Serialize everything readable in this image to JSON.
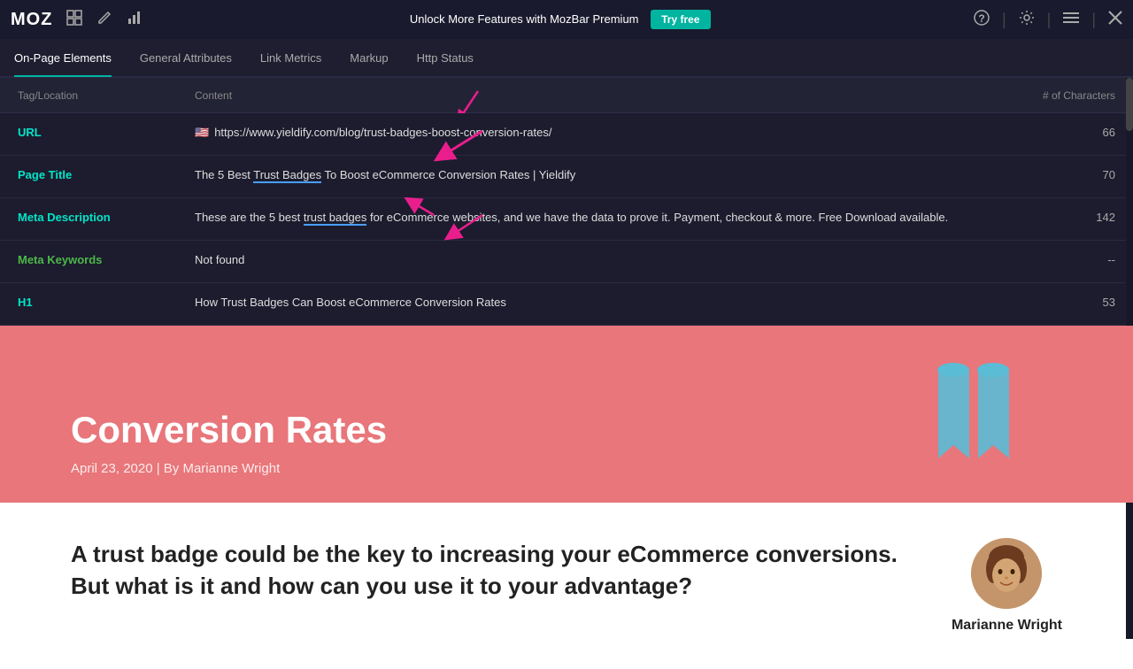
{
  "topbar": {
    "logo": "MOZ",
    "promo_text": "Unlock More Features with MozBar Premium",
    "try_free_label": "Try free",
    "icons": [
      "grid-icon",
      "edit-icon",
      "chart-icon"
    ]
  },
  "tabs": [
    {
      "label": "On-Page Elements",
      "active": true
    },
    {
      "label": "General Attributes",
      "active": false
    },
    {
      "label": "Link Metrics",
      "active": false
    },
    {
      "label": "Markup",
      "active": false
    },
    {
      "label": "Http Status",
      "active": false
    }
  ],
  "table": {
    "headers": {
      "tag": "Tag/Location",
      "content": "Content",
      "chars": "# of Characters"
    },
    "rows": [
      {
        "tag": "URL",
        "tag_color": "cyan",
        "content": "https://www.yieldify.com/blog/trust-badges-boost-conversion-rates/",
        "chars": "66",
        "is_url": true
      },
      {
        "tag": "Page Title",
        "tag_color": "cyan",
        "content": "The 5 Best Trust Badges To Boost eCommerce Conversion Rates | Yieldify",
        "chars": "70",
        "is_url": false
      },
      {
        "tag": "Meta Description",
        "tag_color": "cyan",
        "content": "These are the 5 best trust badges for eCommerce websites, and we have the data to prove it. Payment, checkout & more. Free Download available.",
        "chars": "142",
        "is_url": false
      },
      {
        "tag": "Meta Keywords",
        "tag_color": "green",
        "content": "Not found",
        "chars": "--",
        "is_url": false
      },
      {
        "tag": "H1",
        "tag_color": "cyan",
        "content": "How Trust Badges Can Boost eCommerce Conversion Rates",
        "chars": "53",
        "is_url": false
      }
    ]
  },
  "webpage": {
    "title_line1": "Conversion Rates",
    "date": "April 23, 2020 | By Marianne Wright"
  },
  "article": {
    "teaser": "A trust badge could be the key to increasing your eCommerce conversions. But what is it and how can you use it to your advantage?",
    "author_name": "Marianne Wright"
  }
}
